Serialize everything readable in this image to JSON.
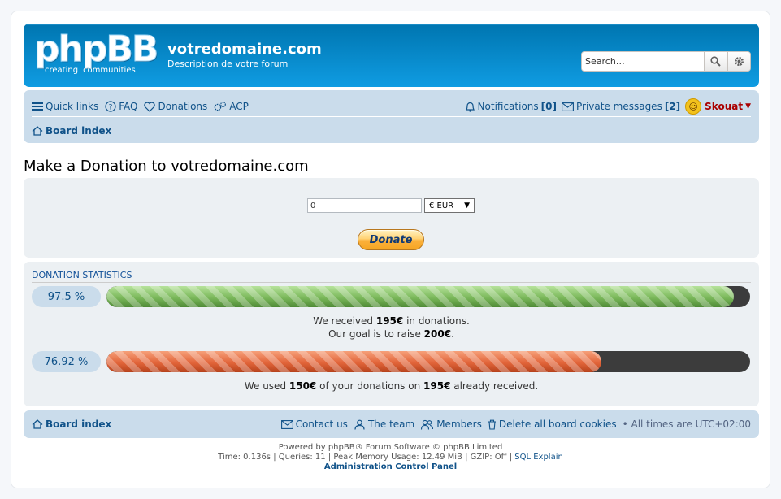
{
  "logo": {
    "main": "phpBB",
    "reg": "®",
    "sub1": "creating",
    "sub2": "communities"
  },
  "site": {
    "title": "votredomaine.com",
    "description": "Description de votre forum"
  },
  "search": {
    "placeholder": "Search…"
  },
  "nav": {
    "quick_links": "Quick links",
    "faq": "FAQ",
    "donations": "Donations",
    "acp": "ACP",
    "notifications_label": "Notifications",
    "notifications_count": "[0]",
    "pm_label": "Private messages",
    "pm_count": "[2]",
    "username": "Skouat",
    "breadcrumb": "Board index"
  },
  "page": {
    "title": "Make a Donation to votredomaine.com"
  },
  "donate_form": {
    "amount_value": "0",
    "currency_selected": "€ EUR",
    "button_label": "Donate"
  },
  "stats": {
    "header": "DONATION STATISTICS",
    "received_pct_label": "97.5 %",
    "received_fill": 0.975,
    "received_line1_a": "We received ",
    "received_amount": "195€",
    "received_line1_b": " in donations.",
    "goal_line_a": "Our goal is to raise ",
    "goal_amount": "200€",
    "goal_line_b": ".",
    "used_pct_label": "76.92 %",
    "used_fill": 0.7692,
    "used_line_a": "We used ",
    "used_amount": "150€",
    "used_line_b": " of your donations on ",
    "used_received": "195€",
    "used_line_c": " already received."
  },
  "footer": {
    "breadcrumb": "Board index",
    "contact": "Contact us",
    "team": "The team",
    "members": "Members",
    "delete_cookies": "Delete all board cookies",
    "timezone": "All times are UTC+02:00",
    "powered": "Powered by phpBB® Forum Software © phpBB Limited",
    "debug_stats": "Time: 0.136s | Queries: 11 | Peak Memory Usage: 12.49 MiB | GZIP: Off | ",
    "sql_explain": "SQL Explain",
    "acp_link": "Administration Control Panel"
  },
  "colors": {
    "header_blue": "#0076b1",
    "link": "#105289",
    "nav_bg": "#cadceb",
    "panel_bg": "#ecf0f3",
    "username": "#aa0000"
  }
}
